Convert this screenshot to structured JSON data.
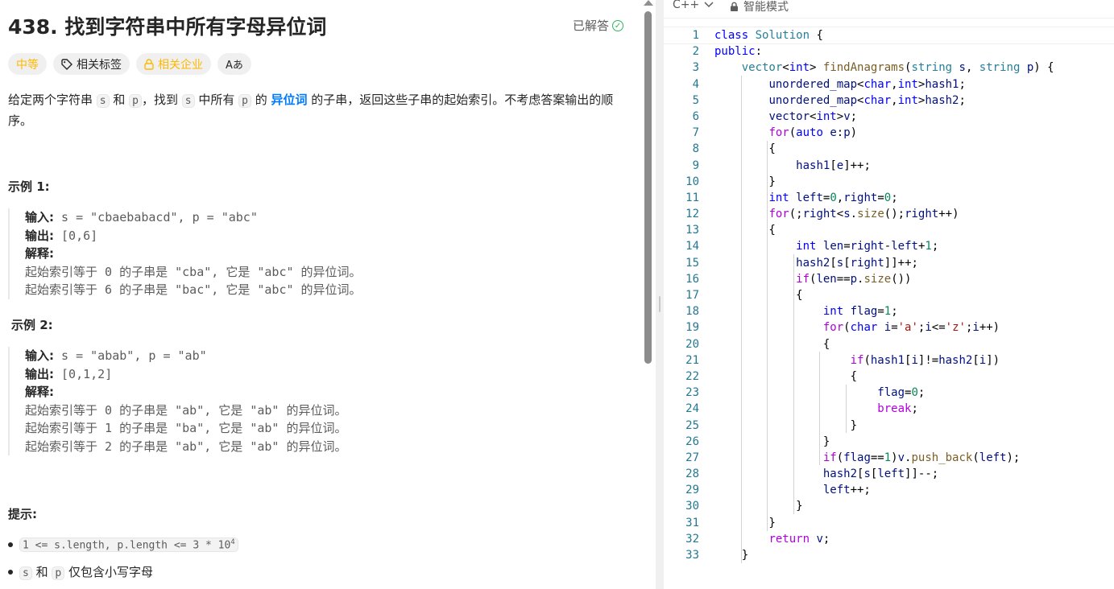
{
  "problem": {
    "title": "438. 找到字符串中所有字母异位词",
    "status": "已解答",
    "tags": {
      "difficulty": "中等",
      "related_tags": "相关标签",
      "related_companies": "相关企业",
      "font_toggle": "Aあ"
    },
    "desc_parts": {
      "p1": "给定两个字符串 ",
      "s": "s",
      "p2": " 和 ",
      "p": "p",
      "p3": "，找到 ",
      "s2": "s",
      "p4": " 中所有 ",
      "p_": "p",
      "p5": " 的 ",
      "link": "异位词",
      "p6": " 的子串，返回这些子串的起始索引。不考虑答案输出的顺序。"
    },
    "example1": {
      "title": "示例 1:",
      "input_label": "输入:",
      "input": "s = \"cbaebabacd\", p = \"abc\"",
      "output_label": "输出:",
      "output": "[0,6]",
      "explain_label": "解释:",
      "explain": [
        "起始索引等于 0 的子串是 \"cba\", 它是 \"abc\" 的异位词。",
        "起始索引等于 6 的子串是 \"bac\", 它是 \"abc\" 的异位词。"
      ]
    },
    "example2": {
      "title": "示例 2:",
      "input_label": "输入:",
      "input": "s = \"abab\", p = \"ab\"",
      "output_label": "输出:",
      "output": "[0,1,2]",
      "explain_label": "解释:",
      "explain": [
        "起始索引等于 0 的子串是 \"ab\", 它是 \"ab\" 的异位词。",
        "起始索引等于 1 的子串是 \"ba\", 它是 \"ab\" 的异位词。",
        "起始索引等于 2 的子串是 \"ab\", 它是 \"ab\" 的异位词。"
      ]
    },
    "hints_title": "提示:",
    "hint1": "1 <= s.length, p.length <= 3 * 10",
    "hint1_sup": "4",
    "hint2_s": "s",
    "hint2_and": " 和 ",
    "hint2_p": "p",
    "hint2_rest": " 仅包含小写字母"
  },
  "editor": {
    "language": "C++",
    "mode": "智能模式",
    "line_numbers": [
      "1",
      "2",
      "3",
      "4",
      "5",
      "6",
      "7",
      "8",
      "9",
      "10",
      "11",
      "12",
      "13",
      "14",
      "15",
      "16",
      "17",
      "18",
      "19",
      "20",
      "21",
      "22",
      "23",
      "24",
      "25",
      "26",
      "27",
      "28",
      "29",
      "30",
      "31",
      "32",
      "33"
    ]
  }
}
